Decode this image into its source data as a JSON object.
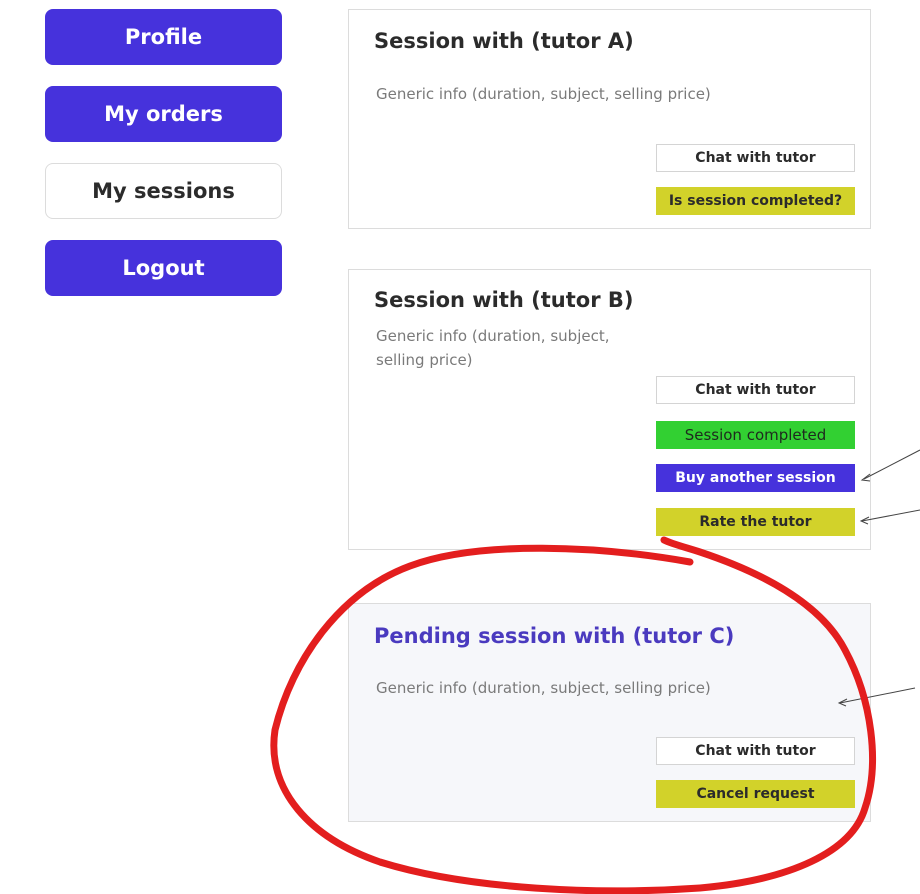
{
  "sidebar": {
    "items": [
      {
        "label": "Profile"
      },
      {
        "label": "My orders"
      },
      {
        "label": "My sessions"
      },
      {
        "label": "Logout"
      }
    ]
  },
  "sessions": [
    {
      "title": "Session with (tutor A)",
      "info": "Generic info (duration, subject, selling price)",
      "chat_label": "Chat with tutor",
      "status_label": "Is session completed?"
    },
    {
      "title": "Session with (tutor B)",
      "info": "Generic info (duration, subject, selling price)",
      "chat_label": "Chat with tutor",
      "completed_label": "Session completed",
      "buy_label": "Buy another session",
      "rate_label": "Rate the tutor"
    },
    {
      "title": "Pending session with (tutor C)",
      "info": "Generic info (duration, subject, selling price)",
      "chat_label": "Chat with tutor",
      "cancel_label": "Cancel request"
    }
  ],
  "colors": {
    "primary": "#4632dc",
    "warning": "#d2d22a",
    "success": "#32d032",
    "annotation": "#e31e1e"
  }
}
